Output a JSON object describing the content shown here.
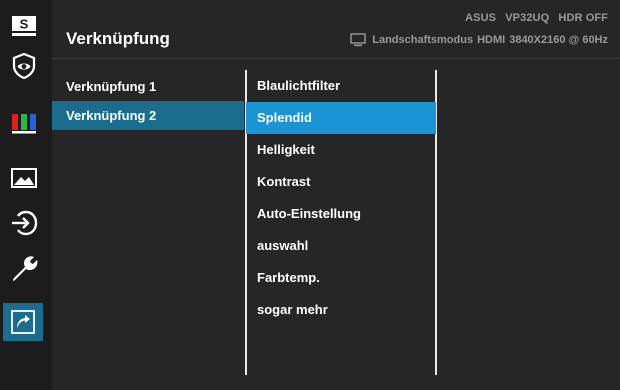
{
  "header": {
    "title": "Verknüpfung",
    "brand": "ASUS",
    "model": "VP32UQ",
    "hdr_status": "HDR OFF",
    "mode": "Landschaftsmodus",
    "input": "HDMI",
    "resolution": "3840X2160 @ 60Hz"
  },
  "sidebar": {
    "items": [
      {
        "icon": "splendid-s-icon",
        "active": false
      },
      {
        "icon": "eye-care-icon",
        "active": false
      },
      {
        "icon": "color-bars-icon",
        "active": false
      },
      {
        "icon": "image-icon",
        "active": false
      },
      {
        "icon": "input-select-icon",
        "active": false
      },
      {
        "icon": "wrench-icon",
        "active": false
      },
      {
        "icon": "shortcut-arrow-icon",
        "active": true
      }
    ]
  },
  "submenu": {
    "items": [
      {
        "label": "Verknüpfung 1",
        "selected": false
      },
      {
        "label": "Verknüpfung 2",
        "selected": true
      }
    ]
  },
  "options": {
    "items": [
      {
        "label": "Blaulichtfilter",
        "selected": false
      },
      {
        "label": "Splendid",
        "selected": true
      },
      {
        "label": "Helligkeit",
        "selected": false
      },
      {
        "label": "Kontrast",
        "selected": false
      },
      {
        "label": "Auto-Einstellung",
        "selected": false
      },
      {
        "label": "auswahl",
        "selected": false
      },
      {
        "label": "Farbtemp.",
        "selected": false
      },
      {
        "label": "sogar mehr",
        "selected": false
      }
    ]
  },
  "colors": {
    "accent_active": "#1a6d8d",
    "accent_selected": "#1a94d4",
    "background": "#262626",
    "sidebar": "#1c1c1c"
  }
}
